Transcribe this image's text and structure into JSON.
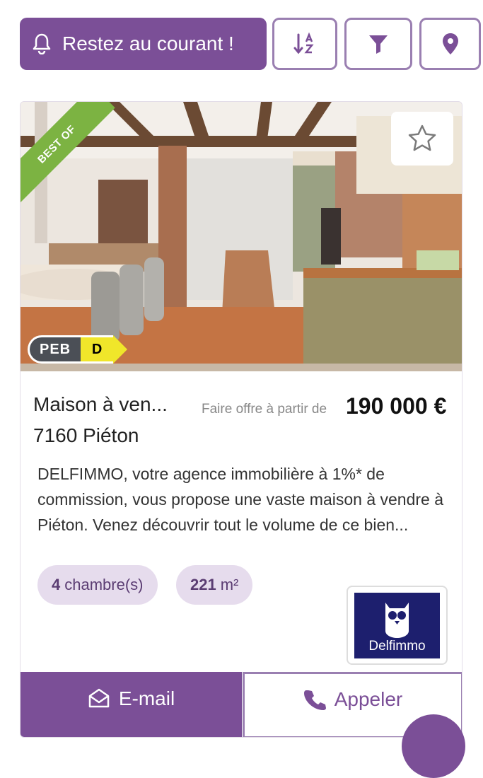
{
  "toolbar": {
    "alert_label": "Restez au courant !",
    "sort_icon": "sort-alpha-icon",
    "filter_icon": "filter-icon",
    "map_icon": "map-pin-icon"
  },
  "listing": {
    "badge": "BEST OF",
    "peb_label": "PEB",
    "peb_grade": "D",
    "title": "Maison à ven...",
    "offer_label": "Faire offre à partir de",
    "price": "190 000 €",
    "city": "7160 Piéton",
    "description": "DELFIMMO, votre agence immobilière à 1%* de commission, vous propose une vaste maison à vendre à Piéton. Venez découvrir tout le volume de ce bien...",
    "features": [
      {
        "count": "4",
        "label": "chambre(s)"
      },
      {
        "count": "221",
        "label": "m²"
      }
    ],
    "agency": "Delfimmo"
  },
  "actions": {
    "email_label": "E-mail",
    "call_label": "Appeler"
  },
  "colors": {
    "accent": "#7b4f97",
    "badge": "#7cb342",
    "peb_d": "#f0e62a"
  }
}
